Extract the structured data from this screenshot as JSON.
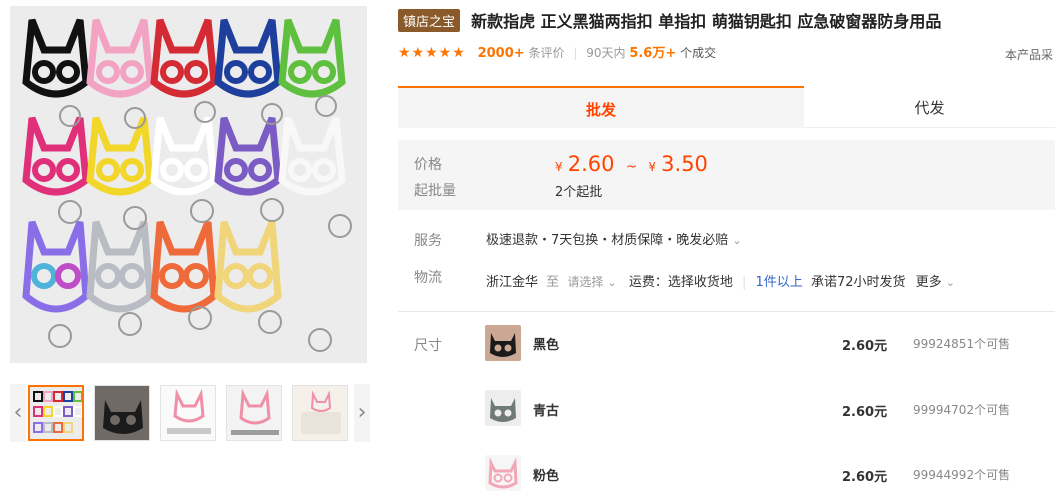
{
  "product": {
    "badge": "镇店之宝",
    "title": "新款指虎 正义黑猫两指扣 单指扣 萌猫钥匙扣 应急破窗器防身用品"
  },
  "rating": {
    "stars": "★★★★★",
    "review_count": "2000+",
    "review_label": "条评价",
    "period": "90天内",
    "sold": "5.6万+",
    "sold_label": "个成交"
  },
  "right_note": "本产品采",
  "tabs": [
    {
      "label": "批发"
    },
    {
      "label": "代发"
    }
  ],
  "price": {
    "label": "价格",
    "currency": "¥",
    "min": "2.60",
    "tilde": "~",
    "max": "3.50",
    "moq_label": "起批量",
    "moq_value": "2个起批"
  },
  "service": {
    "label": "服务",
    "text": "极速退款・7天包换・材质保障・晚发必赔"
  },
  "logistics": {
    "label": "物流",
    "origin": "浙江金华",
    "to": "至",
    "select": "请选择",
    "fee": "运费：选择收货地",
    "tier": "1件以上",
    "promise": "承诺72小时发货",
    "more": "更多"
  },
  "size": {
    "label": "尺寸",
    "items": [
      {
        "name": "黑色",
        "price": "2.60元",
        "stock": "99924851个可售",
        "color": "#222222"
      },
      {
        "name": "青古",
        "price": "2.60元",
        "stock": "99994702个可售",
        "color": "#7f8c86"
      },
      {
        "name": "粉色",
        "price": "2.60元",
        "stock": "99944992个可售",
        "color": "#f2a6b8"
      }
    ]
  },
  "colors": {
    "accent": "#ff7300",
    "price": "#ff4400",
    "badge": "#8b5a2b",
    "link": "#3366cc"
  },
  "icons": {
    "prev": "‹",
    "next": "›",
    "chevron": "⌄"
  }
}
